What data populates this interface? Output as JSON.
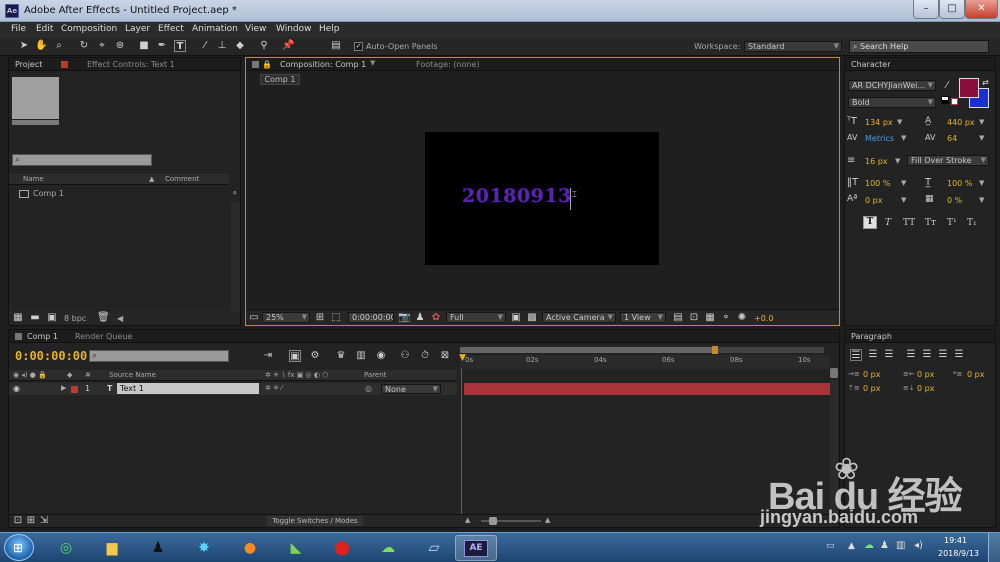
{
  "window": {
    "app_icon": "Ae",
    "title": "Adobe After Effects - Untitled Project.aep *"
  },
  "menu": [
    "File",
    "Edit",
    "Composition",
    "Layer",
    "Effect",
    "Animation",
    "View",
    "Window",
    "Help"
  ],
  "toolbar": {
    "auto_open_label": "Auto-Open Panels",
    "workspace_label": "Workspace:",
    "workspace_value": "Standard",
    "search_placeholder": "Search Help"
  },
  "project_panel": {
    "tab_project": "Project",
    "tab_effect_controls": "Effect Controls: Text 1",
    "col_name": "Name",
    "col_comment": "Comment",
    "item": "Comp 1",
    "bpc": "8 bpc"
  },
  "comp_panel": {
    "tab_comp": "Composition: Comp 1",
    "tab_footage": "Footage: (none)",
    "breadcrumb": "Comp 1",
    "comp_text": "20180913",
    "zoom": "25%",
    "timecode": "0:00:00:00",
    "resolution": "Full",
    "camera": "Active Camera",
    "views": "1 View",
    "exposure": "+0.0"
  },
  "character_panel": {
    "tab": "Character",
    "font_family": "AR DCHYJianWei...",
    "font_style": "Bold",
    "font_size": "134 px",
    "leading": "440 px",
    "kerning": "Metrics",
    "tracking": "64",
    "stroke_width": "16 px",
    "stroke_mode": "Fill Over Stroke",
    "vertical_scale": "100 %",
    "horizontal_scale": "100 %",
    "baseline_shift": "0 px",
    "tsume": "0 %",
    "style_buttons": [
      "T",
      "T",
      "TT",
      "Tт",
      "T¹",
      "T₁"
    ],
    "fill_color": "#8b0f3c",
    "stroke_color": "#1a2fd4"
  },
  "paragraph_panel": {
    "tab": "Paragraph",
    "indent_left": "0 px",
    "indent_right": "0 px",
    "space_before": "0 px",
    "space_after": "0 px",
    "first_indent": "0 px"
  },
  "timeline": {
    "tab_comp": "Comp 1",
    "tab_render": "Render Queue",
    "timecode": "0:00:00:00",
    "col_hash": "#",
    "col_source": "Source Name",
    "col_parent": "Parent",
    "ruler": [
      "0s",
      "02s",
      "04s",
      "06s",
      "08s",
      "10s"
    ],
    "layer_number": "1",
    "layer_name": "Text 1",
    "layer_parent": "None",
    "toggle_label": "Toggle Switches / Modes"
  },
  "taskbar": {
    "ae_label": "AE",
    "time": "19:41",
    "date": "2018/9/13"
  },
  "watermark": {
    "brand": "Bai du 经验",
    "url": "jingyan.baidu.com"
  }
}
